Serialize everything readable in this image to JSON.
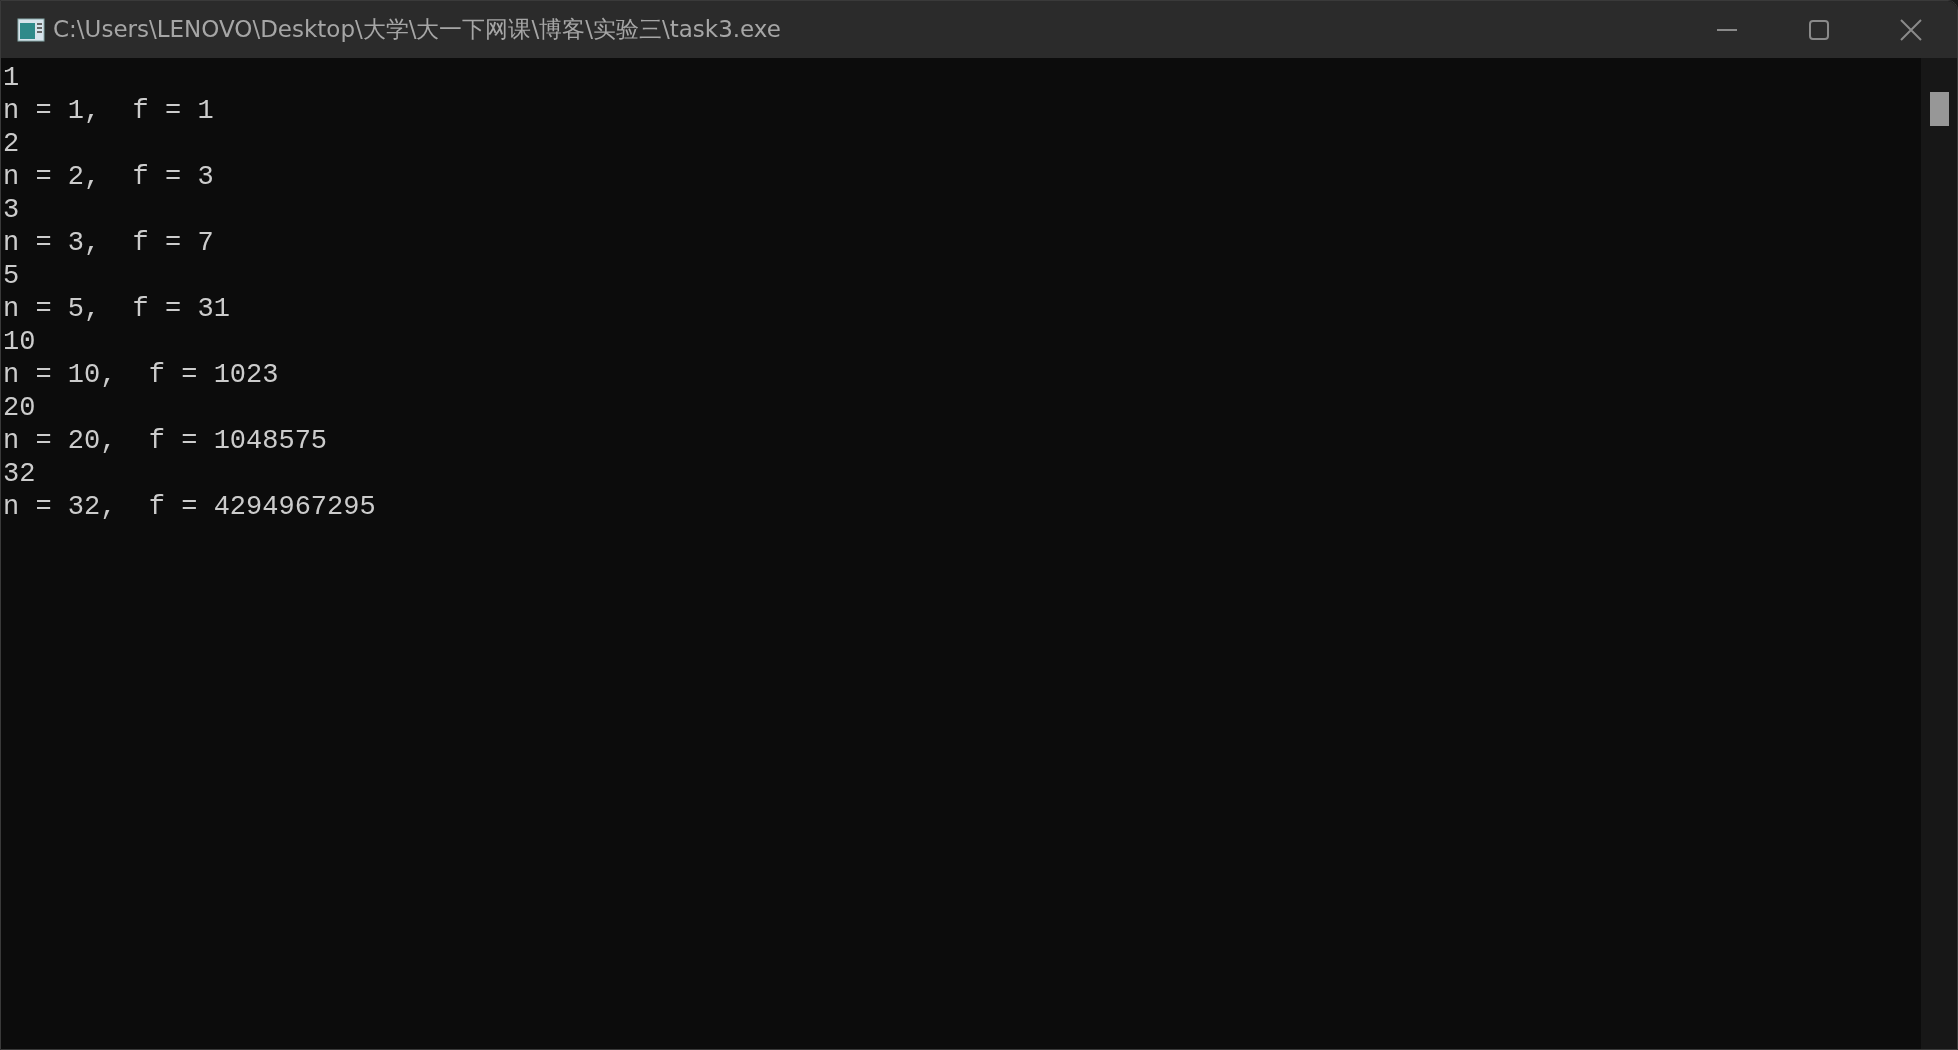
{
  "window": {
    "title": "C:\\Users\\LENOVO\\Desktop\\大学\\大一下网课\\博客\\实验三\\task3.exe"
  },
  "console": {
    "lines": [
      "1",
      "n = 1,  f = 1",
      "2",
      "n = 2,  f = 3",
      "3",
      "n = 3,  f = 7",
      "5",
      "n = 5,  f = 31",
      "10",
      "n = 10,  f = 1023",
      "20",
      "n = 20,  f = 1048575",
      "32",
      "n = 32,  f = 4294967295"
    ]
  }
}
